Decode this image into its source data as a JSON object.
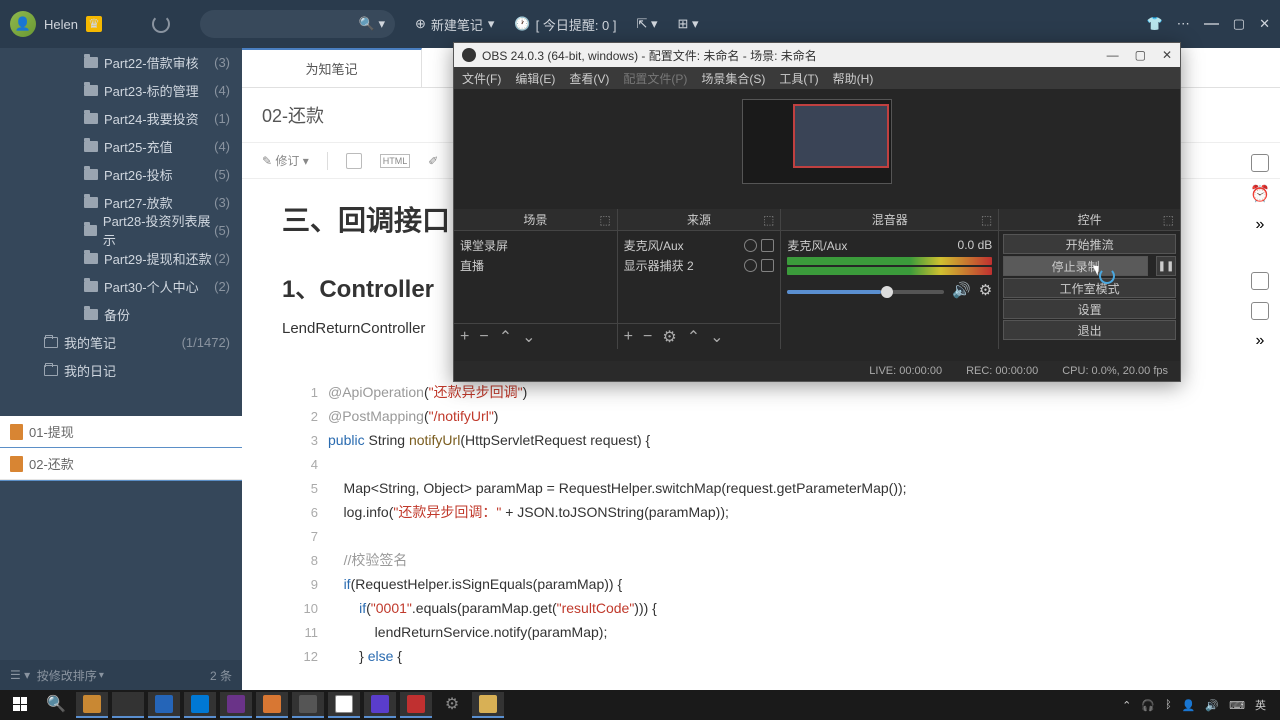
{
  "topbar": {
    "user": "Helen",
    "new_note": "新建笔记",
    "today": "[ 今日提醒: 0 ]"
  },
  "tree": [
    {
      "label": "Part22-借款审核",
      "count": "(3)"
    },
    {
      "label": "Part23-标的管理",
      "count": "(4)"
    },
    {
      "label": "Part24-我要投资",
      "count": "(1)"
    },
    {
      "label": "Part25-充值",
      "count": "(4)"
    },
    {
      "label": "Part26-投标",
      "count": "(5)"
    },
    {
      "label": "Part27-放款",
      "count": "(3)"
    },
    {
      "label": "Part28-投资列表展示",
      "count": "(5)"
    },
    {
      "label": "Part29-提现和还款",
      "count": "(2)"
    },
    {
      "label": "Part30-个人中心",
      "count": "(2)"
    },
    {
      "label": "备份",
      "count": ""
    }
  ],
  "tree_b": [
    {
      "label": "我的笔记",
      "count": "(1/1472)"
    },
    {
      "label": "我的日记",
      "count": ""
    }
  ],
  "sort": {
    "label": "按修改排序",
    "count": "2 条"
  },
  "notes": [
    {
      "label": "01-提现"
    },
    {
      "label": "02-还款"
    }
  ],
  "tab": {
    "active": "为知笔记"
  },
  "note": {
    "title": "02-还款"
  },
  "toolbar": {
    "edit": "修订",
    "html": "HTML"
  },
  "content": {
    "h3": "三、回调接口",
    "h4": "1、Controller",
    "para": "LendReturnController"
  },
  "code": [
    {
      "n": "1",
      "html": "<span class='c-at'>@ApiOperation</span>(<span class='c-str'>\"还款异步回调\"</span>)"
    },
    {
      "n": "2",
      "html": "<span class='c-at'>@PostMapping</span>(<span class='c-str'>\"/notifyUrl\"</span>)"
    },
    {
      "n": "3",
      "html": "<span class='c-kw'>public</span> String <span class='c-fn'>notifyUrl</span>(HttpServletRequest request) {"
    },
    {
      "n": "4",
      "html": ""
    },
    {
      "n": "5",
      "html": "    Map&lt;String, Object&gt; paramMap = RequestHelper.switchMap(request.getParameterMap());"
    },
    {
      "n": "6",
      "html": "    log.info(<span class='c-str'>\"还款异步回调：\"</span> + JSON.toJSONString(paramMap));"
    },
    {
      "n": "7",
      "html": ""
    },
    {
      "n": "8",
      "html": "    <span class='c-cm'>//校验签名</span>"
    },
    {
      "n": "9",
      "html": "    <span class='c-kw'>if</span>(RequestHelper.isSignEquals(paramMap)) {"
    },
    {
      "n": "10",
      "html": "        <span class='c-kw'>if</span>(<span class='c-str'>\"0001\"</span>.equals(paramMap.get(<span class='c-str'>\"resultCode\"</span>))) {"
    },
    {
      "n": "11",
      "html": "            lendReturnService.notify(paramMap);"
    },
    {
      "n": "12",
      "html": "        } <span class='c-kw'>else</span> {"
    }
  ],
  "obs": {
    "title": "OBS 24.0.3 (64-bit, windows) - 配置文件: 未命名 - 场景: 未命名",
    "menu": [
      "文件(F)",
      "编辑(E)",
      "查看(V)",
      "配置文件(P)",
      "场景集合(S)",
      "工具(T)",
      "帮助(H)"
    ],
    "panels": {
      "scene": "场景",
      "source": "来源",
      "mixer": "混音器",
      "ctrl": "控件"
    },
    "scenes": [
      "课堂录屏",
      "直播"
    ],
    "sources": [
      {
        "label": "麦克风/Aux"
      },
      {
        "label": "显示器捕获 2"
      }
    ],
    "mixer": {
      "label": "麦克风/Aux",
      "db": "0.0 dB"
    },
    "ctrls": [
      "开始推流",
      "停止录制",
      "工作室模式",
      "设置",
      "退出"
    ],
    "status": {
      "live": "LIVE: 00:00:00",
      "rec": "REC: 00:00:00",
      "cpu": "CPU: 0.0%, 20.00 fps"
    }
  },
  "tray": {
    "lang": "英"
  }
}
